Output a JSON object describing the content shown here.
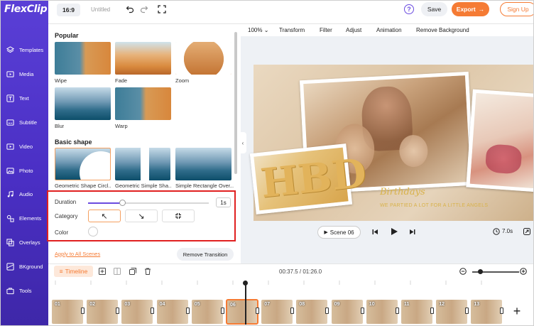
{
  "app": {
    "logo": "FlexClip",
    "aspect_ratio": "16:9",
    "project_title": "Untitled"
  },
  "sidebar": {
    "items": [
      {
        "label": "Templates",
        "icon": "templates-icon"
      },
      {
        "label": "Media",
        "icon": "media-icon"
      },
      {
        "label": "Text",
        "icon": "text-icon"
      },
      {
        "label": "Subtitle",
        "icon": "subtitle-icon"
      },
      {
        "label": "Video",
        "icon": "video-icon"
      },
      {
        "label": "Photo",
        "icon": "photo-icon"
      },
      {
        "label": "Audio",
        "icon": "audio-icon"
      },
      {
        "label": "Elements",
        "icon": "elements-icon"
      },
      {
        "label": "Overlays",
        "icon": "overlays-icon"
      },
      {
        "label": "BKground",
        "icon": "background-icon"
      },
      {
        "label": "Tools",
        "icon": "tools-icon"
      }
    ]
  },
  "topbar": {
    "help": "?",
    "save": "Save",
    "export": "Export",
    "signup": "Sign Up"
  },
  "panel": {
    "popular_title": "Popular",
    "popular": [
      "Wipe",
      "Fade",
      "Zoom",
      "Blur",
      "Warp"
    ],
    "basic_title": "Basic shape",
    "basic": [
      "Geometric Shape Circl...",
      "Geometric Simple Sha...",
      "Simple Rectangle Over..."
    ],
    "duration_label": "Duration",
    "duration_value": "1s",
    "category_label": "Category",
    "color_label": "Color",
    "apply_all": "Apply to All Scenes",
    "remove": "Remove Transition"
  },
  "toolbar": {
    "zoom": "100%",
    "items": [
      "Transform",
      "Filter",
      "Adjust",
      "Animation",
      "Remove Background"
    ]
  },
  "stage": {
    "balloon_text": "HBD",
    "title": "Birthdays",
    "tagline": "WE PARTIED A LOT FOR A LITTLE ANGELS"
  },
  "player": {
    "scene": "Scene 06",
    "duration": "7.0s"
  },
  "timeline": {
    "label": "Timeline",
    "time": "00:37.5 / 01:26.0",
    "clips": [
      "01",
      "02",
      "03",
      "04",
      "05",
      "06",
      "07",
      "08",
      "09",
      "10",
      "11",
      "12",
      "13"
    ],
    "selected_clip": "06"
  },
  "colors": {
    "accent": "#f57b34",
    "brand": "#5a3fd6",
    "highlight": "#e02020"
  }
}
